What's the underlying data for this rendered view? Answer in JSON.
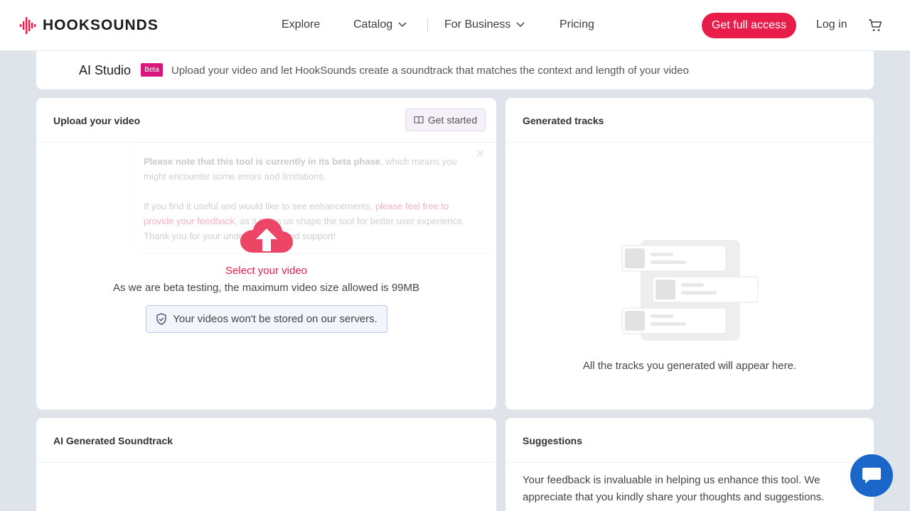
{
  "brand": {
    "name": "HOOKSOUNDS",
    "accent": "#e81d4a"
  },
  "nav": {
    "explore": "Explore",
    "catalog": "Catalog",
    "business": "For Business",
    "pricing": "Pricing",
    "cta": "Get full access",
    "login": "Log in"
  },
  "studio": {
    "title": "AI Studio",
    "badge": "Beta",
    "description": "Upload your video and let HookSounds create a soundtrack that matches the context and length of your video"
  },
  "upload": {
    "title": "Upload your video",
    "get_started": "Get started",
    "notice_bold": "Please note that this tool is currently in its beta phase",
    "notice_rest": ", which means you might encounter some errors and limitations.",
    "notice2_a": "If you find it useful and would like to see enhancements, ",
    "notice2_link": "please feel free to provide your feedback",
    "notice2_b": ", as it helps us shape the tool for better user experience. Thank you for your understanding and support!",
    "select": "Select your video",
    "max_size": "As we are beta testing, the maximum video size allowed is 99MB",
    "privacy": "Your videos won't be stored on our servers."
  },
  "tracks": {
    "title": "Generated tracks",
    "empty": "All the tracks you generated will appear here."
  },
  "soundtrack": {
    "title": "AI Generated Soundtrack"
  },
  "suggestions": {
    "title": "Suggestions",
    "text": "Your feedback is invaluable in helping us enhance this tool. We appreciate that you kindly share your thoughts and suggestions."
  },
  "icons": {
    "logo": "waveform-icon",
    "chevron": "chevron-down-icon",
    "cart": "cart-icon",
    "guide": "book-icon",
    "upload": "cloud-upload-icon",
    "shield": "shield-check-icon",
    "chat": "chat-icon"
  }
}
